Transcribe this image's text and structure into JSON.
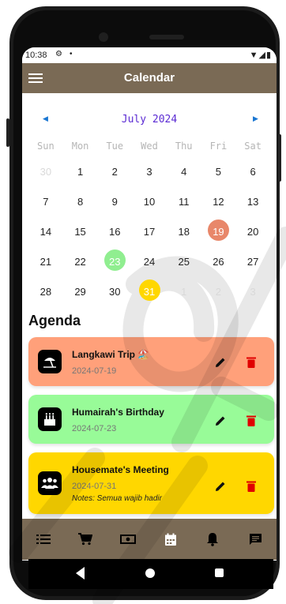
{
  "status_bar": {
    "time": "10:38",
    "settings_icon": "gear-icon",
    "dot": "•",
    "right_icons": "▼◢▮"
  },
  "app_bar": {
    "title": "Calendar",
    "menu_icon": "hamburger-menu-icon"
  },
  "calendar": {
    "month_title": "July 2024",
    "prev_icon": "chevron-left-icon",
    "next_icon": "chevron-right-icon",
    "weekdays": [
      "Sun",
      "Mon",
      "Tue",
      "Wed",
      "Thu",
      "Fri",
      "Sat"
    ],
    "days": [
      {
        "label": "30",
        "muted": true,
        "highlight": ""
      },
      {
        "label": "1",
        "muted": false,
        "highlight": ""
      },
      {
        "label": "2",
        "muted": false,
        "highlight": ""
      },
      {
        "label": "3",
        "muted": false,
        "highlight": ""
      },
      {
        "label": "4",
        "muted": false,
        "highlight": ""
      },
      {
        "label": "5",
        "muted": false,
        "highlight": ""
      },
      {
        "label": "6",
        "muted": false,
        "highlight": ""
      },
      {
        "label": "7",
        "muted": false,
        "highlight": ""
      },
      {
        "label": "8",
        "muted": false,
        "highlight": ""
      },
      {
        "label": "9",
        "muted": false,
        "highlight": ""
      },
      {
        "label": "10",
        "muted": false,
        "highlight": ""
      },
      {
        "label": "11",
        "muted": false,
        "highlight": ""
      },
      {
        "label": "12",
        "muted": false,
        "highlight": ""
      },
      {
        "label": "13",
        "muted": false,
        "highlight": ""
      },
      {
        "label": "14",
        "muted": false,
        "highlight": ""
      },
      {
        "label": "15",
        "muted": false,
        "highlight": ""
      },
      {
        "label": "16",
        "muted": false,
        "highlight": ""
      },
      {
        "label": "17",
        "muted": false,
        "highlight": ""
      },
      {
        "label": "18",
        "muted": false,
        "highlight": ""
      },
      {
        "label": "19",
        "muted": false,
        "highlight": "#e8876a"
      },
      {
        "label": "20",
        "muted": false,
        "highlight": ""
      },
      {
        "label": "21",
        "muted": false,
        "highlight": ""
      },
      {
        "label": "22",
        "muted": false,
        "highlight": ""
      },
      {
        "label": "23",
        "muted": false,
        "highlight": "#90ee90"
      },
      {
        "label": "24",
        "muted": false,
        "highlight": ""
      },
      {
        "label": "25",
        "muted": false,
        "highlight": ""
      },
      {
        "label": "26",
        "muted": false,
        "highlight": ""
      },
      {
        "label": "27",
        "muted": false,
        "highlight": ""
      },
      {
        "label": "28",
        "muted": false,
        "highlight": ""
      },
      {
        "label": "29",
        "muted": false,
        "highlight": ""
      },
      {
        "label": "30",
        "muted": false,
        "highlight": ""
      },
      {
        "label": "31",
        "muted": false,
        "highlight": "#ffd700"
      },
      {
        "label": "1",
        "muted": true,
        "highlight": ""
      },
      {
        "label": "2",
        "muted": true,
        "highlight": ""
      },
      {
        "label": "3",
        "muted": true,
        "highlight": ""
      }
    ]
  },
  "agenda": {
    "title": "Agenda",
    "items": [
      {
        "title": "Langkawi Trip 🏖️",
        "date": "2024-07-19",
        "notes": "",
        "icon": "beach-umbrella-icon",
        "color": "#ffa07a"
      },
      {
        "title": "Humairah's Birthday",
        "date": "2024-07-23",
        "notes": "",
        "icon": "cake-icon",
        "color": "#98fb98"
      },
      {
        "title": "Housemate's Meeting",
        "date": "2024-07-31",
        "notes": "Notes: Semua wajib hadir",
        "icon": "group-icon",
        "color": "#ffd700"
      }
    ],
    "edit_icon": "pencil-icon",
    "delete_icon": "trash-icon"
  },
  "bottom_nav": {
    "items": [
      "list-icon",
      "cart-icon",
      "cash-icon",
      "calendar-icon",
      "bell-icon",
      "chat-icon"
    ]
  },
  "colors": {
    "app_bar": "#7a6a55",
    "month_title": "#5b2bd3",
    "delete": "#e00000"
  },
  "android_nav": [
    "back-icon",
    "home-icon",
    "recent-apps-icon"
  ]
}
